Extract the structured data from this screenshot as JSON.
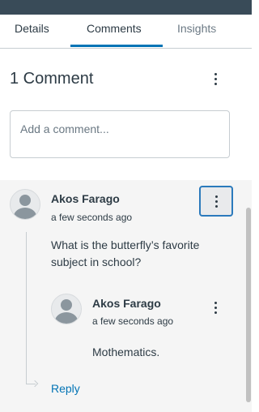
{
  "tabs": [
    {
      "label": "Details"
    },
    {
      "label": "Comments"
    },
    {
      "label": "Insights"
    }
  ],
  "comments_header": {
    "title": "1 Comment"
  },
  "add_comment": {
    "placeholder": "Add a comment..."
  },
  "comments": [
    {
      "author": "Akos Farago",
      "time": "a few seconds ago",
      "text": "What is the butterfly’s favorite subject in school?",
      "replies": [
        {
          "author": "Akos Farago",
          "time": "a few seconds ago",
          "text": "Mothematics."
        }
      ],
      "reply_label": "Reply"
    }
  ],
  "colors": {
    "accent": "#0374b5",
    "top_bar": "#394b58",
    "thread_background": "#f5f5f5",
    "focus_outline": "#2b7abc"
  },
  "icons": {
    "menu": "kebab-menu-icon",
    "avatar": "user-avatar-icon",
    "reply": "reply-arrow-icon"
  }
}
